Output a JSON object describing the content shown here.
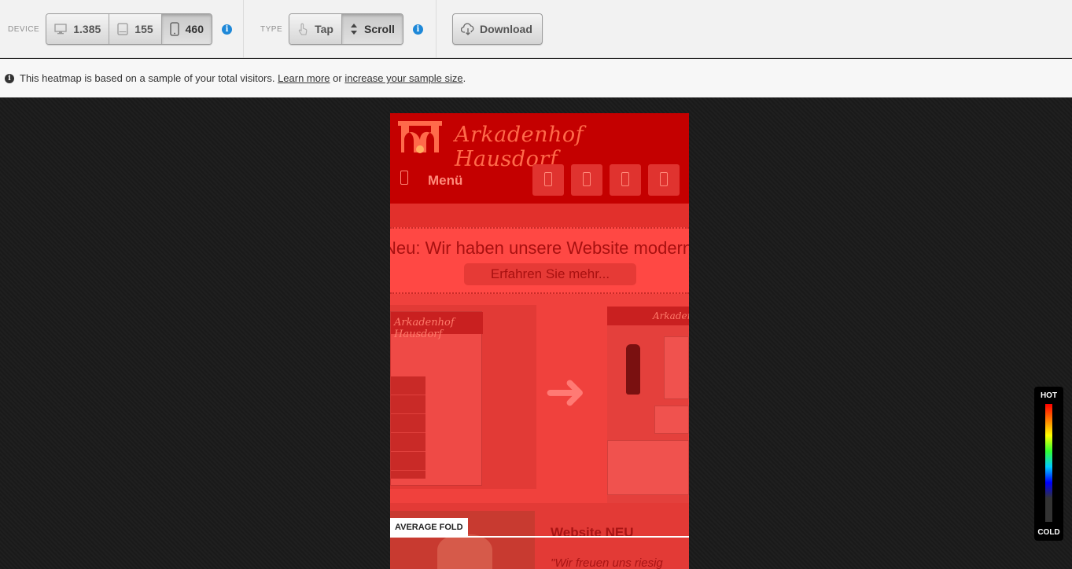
{
  "toolbar": {
    "device": {
      "label": "DEVICE",
      "options": [
        {
          "value": "1.385",
          "icon": "desktop-icon"
        },
        {
          "value": "155",
          "icon": "tablet-icon"
        },
        {
          "value": "460",
          "icon": "phone-icon",
          "active": true
        }
      ]
    },
    "type": {
      "label": "TYPE",
      "options": [
        {
          "value": "Tap",
          "icon": "tap-icon"
        },
        {
          "value": "Scroll",
          "icon": "scroll-icon",
          "active": true
        }
      ]
    },
    "download_label": "Download",
    "info_glyph": "i"
  },
  "notice": {
    "text": "This heatmap is based on a sample of your total visitors.",
    "link1": "Learn more",
    "or": "or",
    "link2": "increase your sample size",
    "end": "."
  },
  "page": {
    "logo": "Arkadenhof Hausdorf",
    "menu": "Menü",
    "banner_text": "Neu: Wir haben unsere Website modernisiert",
    "banner_button": "Erfahren Sie mehr...",
    "thumb_left_logo": "Arkadenhof Hausdorf",
    "thumb_right_logo": "Arkadenhof",
    "arrow": "➜",
    "section_title": "Website NEU",
    "quote": "\"Wir freuen uns riesig"
  },
  "fold_label": "AVERAGE FOLD",
  "legend": {
    "hot": "HOT",
    "cold": "COLD"
  },
  "colors": {
    "hot": "#ff0000",
    "cold": "#0000ff",
    "info": "#1e88d8",
    "page_overlay": "#ff4844"
  }
}
